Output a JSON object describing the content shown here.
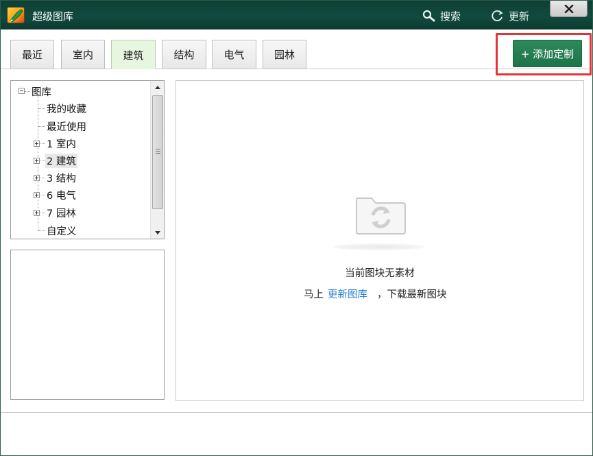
{
  "window": {
    "title": "超级图库",
    "search_label": "搜索",
    "update_label": "更新",
    "close_label": "X"
  },
  "tabs": [
    {
      "label": "最近",
      "active": false
    },
    {
      "label": "室内",
      "active": false
    },
    {
      "label": "建筑",
      "active": true
    },
    {
      "label": "结构",
      "active": false
    },
    {
      "label": "电气",
      "active": false
    },
    {
      "label": "园林",
      "active": false
    }
  ],
  "add_custom_label": "+ 添加定制",
  "tree": {
    "root": "图库",
    "items": [
      {
        "label": "我的收藏",
        "expandable": false
      },
      {
        "label": "最近使用",
        "expandable": false
      },
      {
        "label": "1 室内",
        "expandable": true
      },
      {
        "label": "2 建筑",
        "expandable": true,
        "selected": true
      },
      {
        "label": "3 结构",
        "expandable": true
      },
      {
        "label": "6 电气",
        "expandable": true
      },
      {
        "label": "7 园林",
        "expandable": true
      },
      {
        "label": "自定义",
        "expandable": false
      }
    ]
  },
  "empty_state": {
    "title": "当前图块无素材",
    "hint_prefix": "马上",
    "hint_link": "更新图库",
    "hint_suffix": "，下载最新图块"
  },
  "icons": {
    "search": "search-icon",
    "update": "refresh-icon",
    "close": "close-icon",
    "folder_refresh": "folder-refresh-icon"
  },
  "colors": {
    "titlebar": "#104a3e",
    "accent_button": "#1e7349",
    "highlight_box": "#e53232",
    "active_tab": "#e7f6e0",
    "link": "#2a7fd4"
  }
}
